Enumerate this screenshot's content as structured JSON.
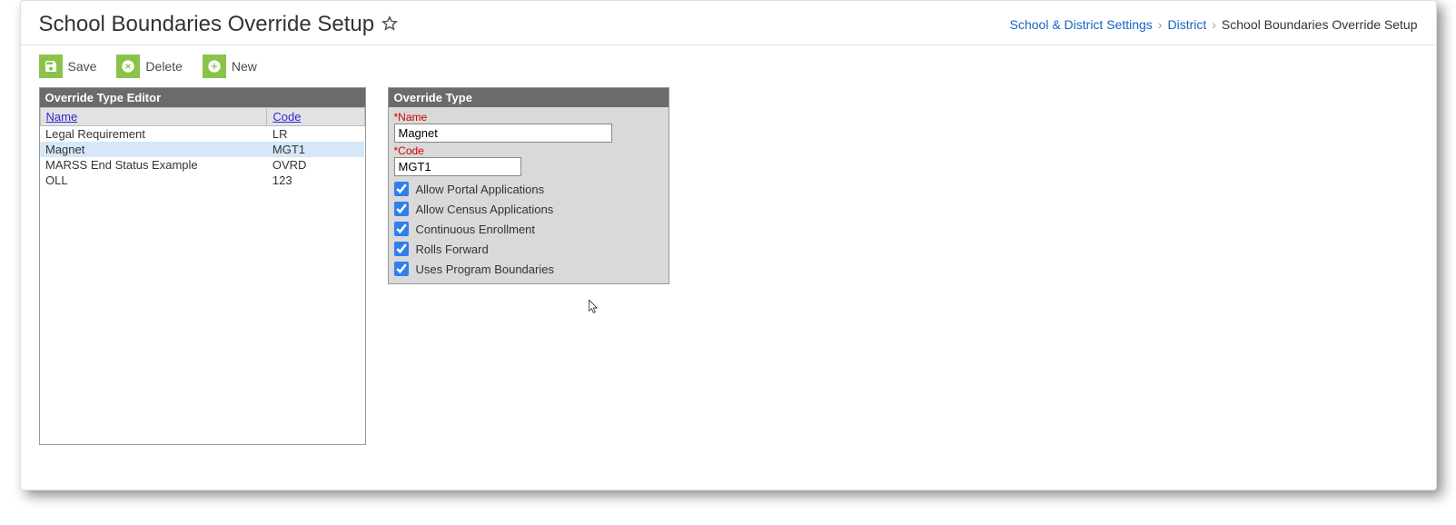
{
  "header": {
    "title": "School Boundaries Override Setup"
  },
  "breadcrumb": {
    "items": [
      {
        "label": "School & District Settings",
        "link": true
      },
      {
        "label": "District",
        "link": true
      },
      {
        "label": "School Boundaries Override Setup",
        "link": false
      }
    ]
  },
  "toolbar": {
    "save_label": "Save",
    "delete_label": "Delete",
    "new_label": "New"
  },
  "editor": {
    "panel_title": "Override Type Editor",
    "columns": {
      "name": "Name",
      "code": "Code"
    },
    "rows": [
      {
        "name": "Legal Requirement",
        "code": "LR",
        "selected": false
      },
      {
        "name": "Magnet",
        "code": "MGT1",
        "selected": true
      },
      {
        "name": "MARSS End Status Example",
        "code": "OVRD",
        "selected": false
      },
      {
        "name": "OLL",
        "code": "123",
        "selected": false
      }
    ]
  },
  "form": {
    "panel_title": "Override Type",
    "name_label": "*Name",
    "name_value": "Magnet",
    "code_label": "*Code",
    "code_value": "MGT1",
    "checks": [
      {
        "label": "Allow Portal Applications",
        "checked": true
      },
      {
        "label": "Allow Census Applications",
        "checked": true
      },
      {
        "label": "Continuous Enrollment",
        "checked": true
      },
      {
        "label": "Rolls Forward",
        "checked": true
      },
      {
        "label": "Uses Program Boundaries",
        "checked": true
      }
    ]
  }
}
